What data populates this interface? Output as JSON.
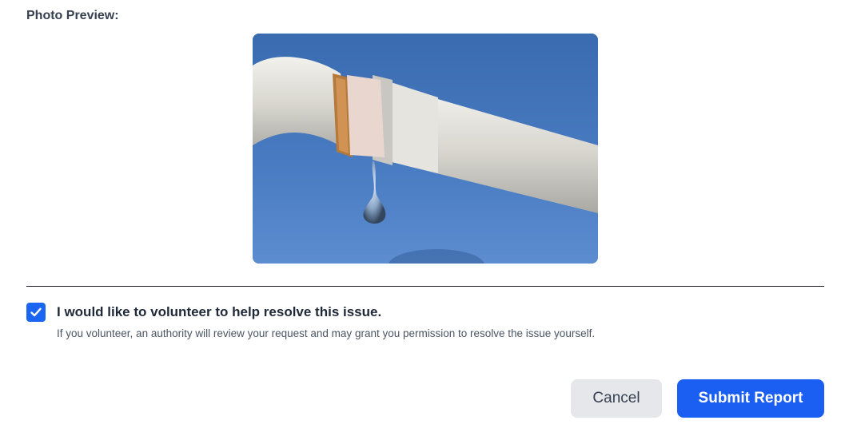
{
  "preview": {
    "label": "Photo Preview:",
    "image_subject": "dripping-faucet-photo"
  },
  "volunteer": {
    "checked": true,
    "label": "I would like to volunteer to help resolve this issue.",
    "help": "If you volunteer, an authority will review your request and may grant you permission to resolve the issue yourself."
  },
  "actions": {
    "cancel_label": "Cancel",
    "submit_label": "Submit Report"
  },
  "colors": {
    "accent": "#1a5ff2",
    "cancel_bg": "#e5e7eb"
  }
}
